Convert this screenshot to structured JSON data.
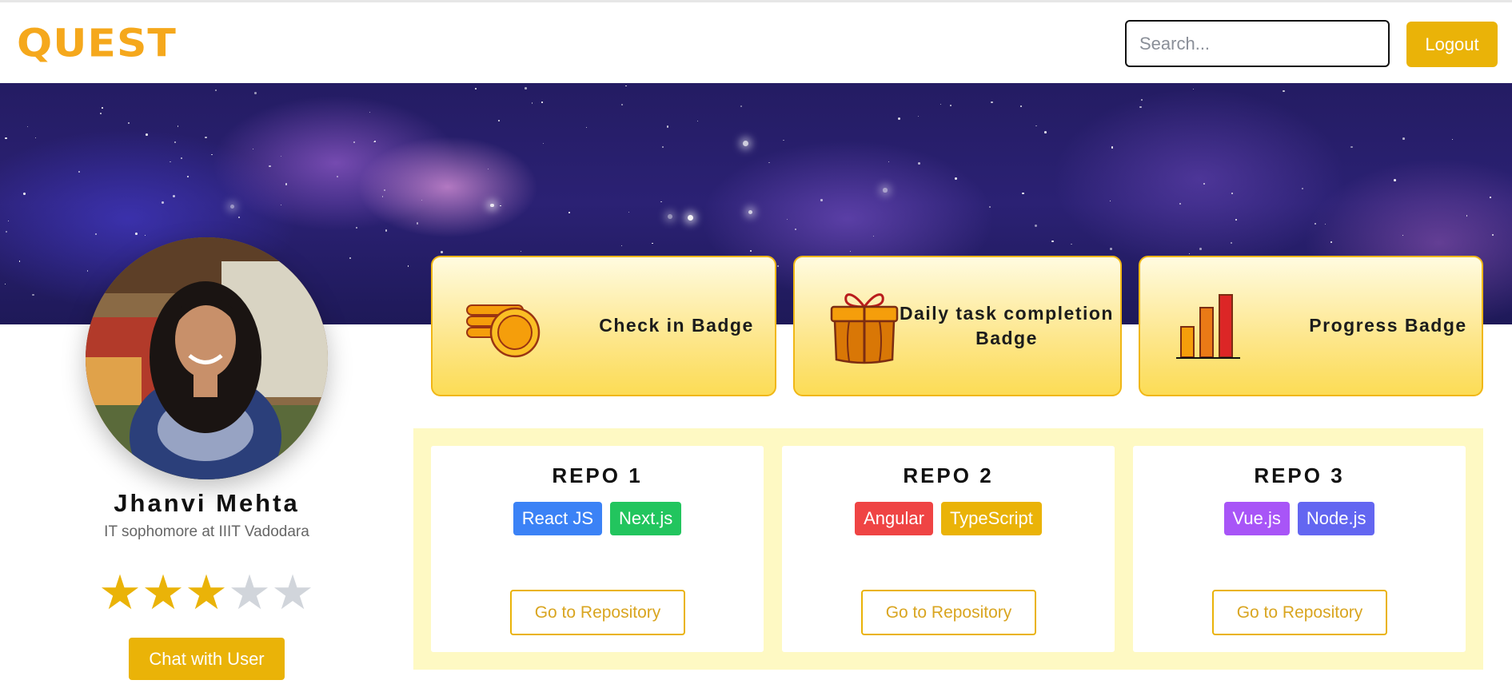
{
  "header": {
    "logo": "QUEST",
    "search_placeholder": "Search...",
    "logout_label": "Logout"
  },
  "profile": {
    "name": "Jhanvi Mehta",
    "subtitle": "IT sophomore at IIIT Vadodara",
    "rating": 3,
    "rating_max": 5,
    "chat_label": "Chat with User"
  },
  "badges": [
    {
      "title": "Check in Badge",
      "icon": "coins-icon"
    },
    {
      "title": "Daily task completion Badge",
      "icon": "gift-box-icon"
    },
    {
      "title": "Progress Badge",
      "icon": "bar-chart-icon"
    }
  ],
  "repos": [
    {
      "title": "REPO 1",
      "tags": [
        {
          "label": "React JS",
          "color": "#3b82f6"
        },
        {
          "label": "Next.js",
          "color": "#22c55e"
        }
      ],
      "button": "Go to Repository"
    },
    {
      "title": "REPO 2",
      "tags": [
        {
          "label": "Angular",
          "color": "#ef4444"
        },
        {
          "label": "TypeScript",
          "color": "#eab308"
        }
      ],
      "button": "Go to Repository"
    },
    {
      "title": "REPO 3",
      "tags": [
        {
          "label": "Vue.js",
          "color": "#a855f7"
        },
        {
          "label": "Node.js",
          "color": "#6366f1"
        }
      ],
      "button": "Go to Repository"
    }
  ],
  "colors": {
    "accent": "#eab308",
    "logo": "#f5a81c",
    "star_filled": "#eab308",
    "star_empty": "#d1d5db",
    "repo_panel_bg": "#fef9c3"
  }
}
